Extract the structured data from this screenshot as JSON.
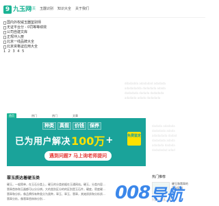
{
  "header": {
    "logo_mark": "9",
    "logo_text": "九玉网",
    "nav": [
      "首页",
      "玉器识别",
      "知识大全",
      "关于我们"
    ]
  },
  "image_links": [
    "国内外权威玉器鉴别师",
    "无证平台分 - 0罚等等绩效",
    "公司自建文库",
    "正规冲入册",
    "北京一线品牌大全",
    "北京资格证应用大全"
  ],
  "pager": "1 2 3 4 5",
  "ghost_text": [
    "ddadadda adadadad adadada",
    "adadadadda dadadada adada",
    "dadadada dadada dadadada",
    "adadada adada dadadada"
  ],
  "tabs": [
    "首页",
    "热门",
    "热门",
    "文章"
  ],
  "banner": {
    "tags": [
      "种类",
      "真假",
      "价钱",
      "保养"
    ],
    "headline_pre": "已为用户解决",
    "headline_num": "100万",
    "headline_post": "+",
    "badge": "免费鉴定",
    "button": "遇到问题7 马上询老师提问"
  },
  "side_faint": [
    "dadada adadada",
    "dadadada adada",
    "adadadada dadad",
    "dadadada adada",
    "adadada dadada",
    "dadadadad adad"
  ],
  "article": {
    "title": "翠玉质达着硬玉类",
    "lines": [
      "硬玉，一般简单，在玉石分类上，硬玉的分类依据在玉通网站。硬玉，分类内容…",
      "翡翠首饰和玉器都可以分分辨，大的类别区分的的区别是玉石件，硬度，密度硬…",
      "翡翠和分析，像品牌所有种类分为类种，翠玉、翠玉、翡翠，其她质质和分析质…",
      "翡翠分析，像翡翠首饰饰分别…"
    ]
  },
  "right_sidebar": {
    "title": "热门推荐",
    "item_lines": [
      "硬玉和翡翠的",
      "区分区别"
    ],
    "extra": "只是一块玉，翠玉…"
  },
  "watermark": {
    "num": "008",
    "text": "导航"
  }
}
